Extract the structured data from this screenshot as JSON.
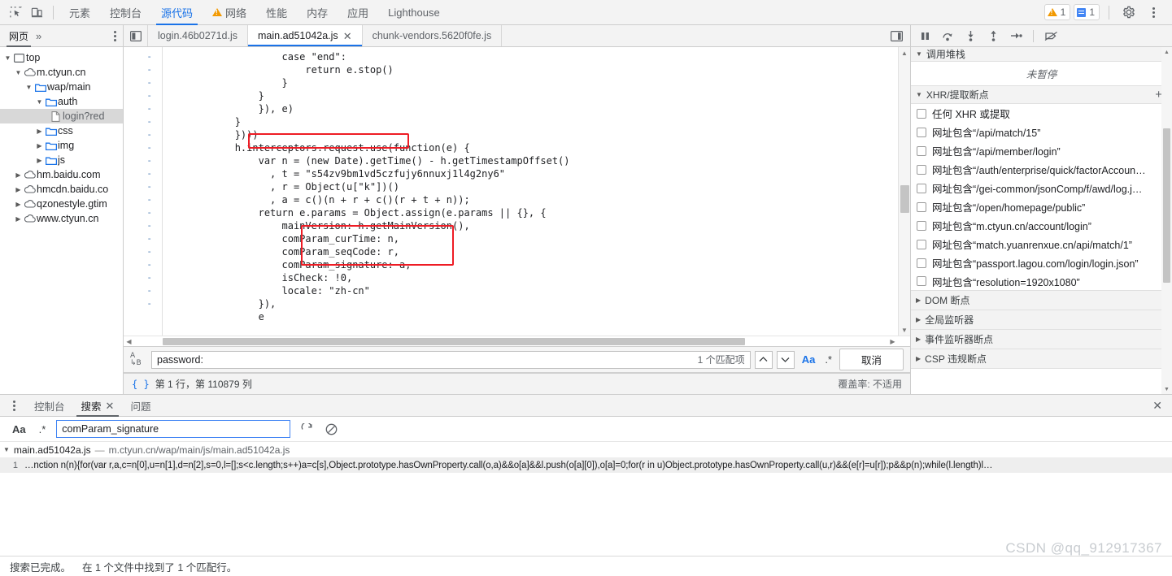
{
  "toolbar": {
    "inspect_icon": "inspect-element-icon",
    "device_icon": "device-toolbar-icon",
    "tabs": [
      {
        "label": "元素",
        "active": false,
        "warn": false
      },
      {
        "label": "控制台",
        "active": false,
        "warn": false
      },
      {
        "label": "源代码",
        "active": true,
        "warn": false
      },
      {
        "label": "网络",
        "active": false,
        "warn": true
      },
      {
        "label": "性能",
        "active": false,
        "warn": false
      },
      {
        "label": "内存",
        "active": false,
        "warn": false
      },
      {
        "label": "应用",
        "active": false,
        "warn": false
      },
      {
        "label": "Lighthouse",
        "active": false,
        "warn": false
      }
    ],
    "warning_count": "1",
    "info_count": "1",
    "settings_icon": "gear-icon",
    "more_icon": "kebab-menu-icon"
  },
  "navigator": {
    "tabs": [
      {
        "label": "网页",
        "active": true
      }
    ],
    "more_label": "»",
    "tree": [
      {
        "label": "top",
        "indent": 0,
        "twisty": "open",
        "icon": "frame",
        "selected": false
      },
      {
        "label": "m.ctyun.cn",
        "indent": 1,
        "twisty": "open",
        "icon": "cloud",
        "selected": false
      },
      {
        "label": "wap/main",
        "indent": 2,
        "twisty": "open",
        "icon": "folder",
        "selected": false
      },
      {
        "label": "auth",
        "indent": 3,
        "twisty": "open",
        "icon": "folder",
        "selected": false
      },
      {
        "label": "login?red",
        "indent": 4,
        "twisty": "none",
        "icon": "doc",
        "selected": true
      },
      {
        "label": "css",
        "indent": 3,
        "twisty": "closed",
        "icon": "folder",
        "selected": false
      },
      {
        "label": "img",
        "indent": 3,
        "twisty": "closed",
        "icon": "folder",
        "selected": false
      },
      {
        "label": "js",
        "indent": 3,
        "twisty": "closed",
        "icon": "folder",
        "selected": false
      },
      {
        "label": "hm.baidu.com",
        "indent": 1,
        "twisty": "closed",
        "icon": "cloud",
        "selected": false
      },
      {
        "label": "hmcdn.baidu.co",
        "indent": 1,
        "twisty": "closed",
        "icon": "cloud",
        "selected": false
      },
      {
        "label": "qzonestyle.gtim",
        "indent": 1,
        "twisty": "closed",
        "icon": "cloud",
        "selected": false
      },
      {
        "label": "www.ctyun.cn",
        "indent": 1,
        "twisty": "closed",
        "icon": "cloud",
        "selected": false
      }
    ]
  },
  "editor": {
    "file_tabs": [
      {
        "label": "login.46b0271d.js",
        "active": false,
        "closable": false
      },
      {
        "label": "main.ad51042a.js",
        "active": true,
        "closable": true
      },
      {
        "label": "chunk-vendors.5620f0fe.js",
        "active": false,
        "closable": false
      }
    ],
    "panel_toggle_icon": "show-navigator-icon",
    "split_icon": "split-editor-icon",
    "gutter_marks": [
      "-",
      "-",
      "-",
      "-",
      "-",
      "-",
      "-",
      "-",
      "-",
      "-",
      "-",
      "-",
      "-",
      "-",
      "-",
      "-",
      "-",
      "-",
      "-",
      "-"
    ],
    "code_lines": [
      "                    case \"end\":",
      "                        return e.stop()",
      "                    }",
      "                }",
      "                }), e)",
      "            }",
      "            })))",
      "            h.interceptors.request.use(function(e) {",
      "                var n = (new Date).getTime() - h.getTimestampOffset()",
      "                  , t = \"s54zv9bm1vd5czfujy6nnuxj1l4g2ny6\"",
      "                  , r = Object(u[\"k\"])()",
      "                  , a = c()(n + r + c()(r + t + n));",
      "                return e.params = Object.assign(e.params || {}, {",
      "                    mainVersion: h.getMainVersion(),",
      "                    comParam_curTime: n,",
      "                    comParam_seqCode: r,",
      "                    comParam_signature: a,",
      "                    isCheck: !0,",
      "                    locale: \"zh-cn\"",
      "                }),",
      "                e"
    ],
    "highlights": [
      {
        "name": "interceptors-highlight",
        "text": "h.interceptors.request.use"
      },
      {
        "name": "comparam-highlight",
        "text": "comParam_curTime / comParam_seqCode / comParam_signature"
      }
    ],
    "highlight_color": "#ee1c25",
    "search": {
      "case_icon": "match-case-ab-icon",
      "value": "password:",
      "placeholder": "",
      "match_count": "1 个匹配项",
      "prev_label": "∧",
      "next_label": "∨",
      "match_case_label": "Aa",
      "regex_label": ".*",
      "cancel_label": "取消"
    },
    "status": {
      "format_icon": "pretty-print-braces-icon",
      "position": "第 1 行，第 110879 列",
      "coverage": "覆盖率: 不适用"
    }
  },
  "debugger": {
    "controls": [
      {
        "name": "pause-resume-button",
        "icon": "pause-icon"
      },
      {
        "name": "step-over-button",
        "icon": "step-over-icon"
      },
      {
        "name": "step-into-button",
        "icon": "step-into-icon"
      },
      {
        "name": "step-out-button",
        "icon": "step-out-icon"
      },
      {
        "name": "step-button",
        "icon": "step-icon"
      },
      {
        "name": "deactivate-breakpoints-button",
        "icon": "deactivate-breakpoints-icon"
      }
    ],
    "call_stack_title": "调用堆栈",
    "not_paused_text": "未暂停",
    "xhr_section_title": "XHR/提取断点",
    "add_label": "+",
    "breakpoints": [
      {
        "label": "任何 XHR 或提取",
        "checked": false
      },
      {
        "label": "网址包含“/api/match/15”",
        "checked": false
      },
      {
        "label": "网址包含“/api/member/login”",
        "checked": false
      },
      {
        "label": "网址包含“/auth/enterprise/quick/factorAccoun…",
        "checked": false
      },
      {
        "label": "网址包含“/gei-common/jsonComp/f/awd/log.j…",
        "checked": false
      },
      {
        "label": "网址包含“/open/homepage/public”",
        "checked": false
      },
      {
        "label": "网址包含“m.ctyun.cn/account/login”",
        "checked": false
      },
      {
        "label": "网址包含“match.yuanrenxue.cn/api/match/1”",
        "checked": false
      },
      {
        "label": "网址包含“passport.lagou.com/login/login.json”",
        "checked": false
      },
      {
        "label": "网址包含“resolution=1920x1080”",
        "checked": false
      }
    ],
    "sections": [
      {
        "label": "DOM 断点"
      },
      {
        "label": "全局监听器"
      },
      {
        "label": "事件监听器断点"
      },
      {
        "label": "CSP 违规断点"
      }
    ]
  },
  "drawer": {
    "menu_icon": "kebab-menu-icon",
    "tabs": [
      {
        "label": "控制台",
        "active": false,
        "closable": false
      },
      {
        "label": "搜索",
        "active": true,
        "closable": true
      },
      {
        "label": "问题",
        "active": false,
        "closable": false
      }
    ],
    "close_label": "✕",
    "search": {
      "match_case_label": "Aa",
      "regex_label": ".*",
      "value": "comParam_signature",
      "placeholder": "",
      "refresh_icon": "refresh-icon",
      "clear_icon": "clear-icon"
    },
    "results": [
      {
        "file": "main.ad51042a.js",
        "dash": "—",
        "url": "m.ctyun.cn/wap/main/js/main.ad51042a.js",
        "lines": [
          {
            "no": "1",
            "text": "…nction n(n){for(var r,a,c=n[0],u=n[1],d=n[2],s=0,l=[];s<c.length;s++)a=c[s],Object.prototype.hasOwnProperty.call(o,a)&&o[a]&&l.push(o[a][0]),o[a]=0;for(r in u)Object.prototype.hasOwnProperty.call(u,r)&&(e[r]=u[r]);p&&p(n);while(l.length)l…"
          }
        ]
      }
    ],
    "footer": {
      "status": "搜索已完成。",
      "detail": "在 1 个文件中找到了 1 个匹配行。"
    }
  },
  "watermark": "CSDN @qq_912917367"
}
